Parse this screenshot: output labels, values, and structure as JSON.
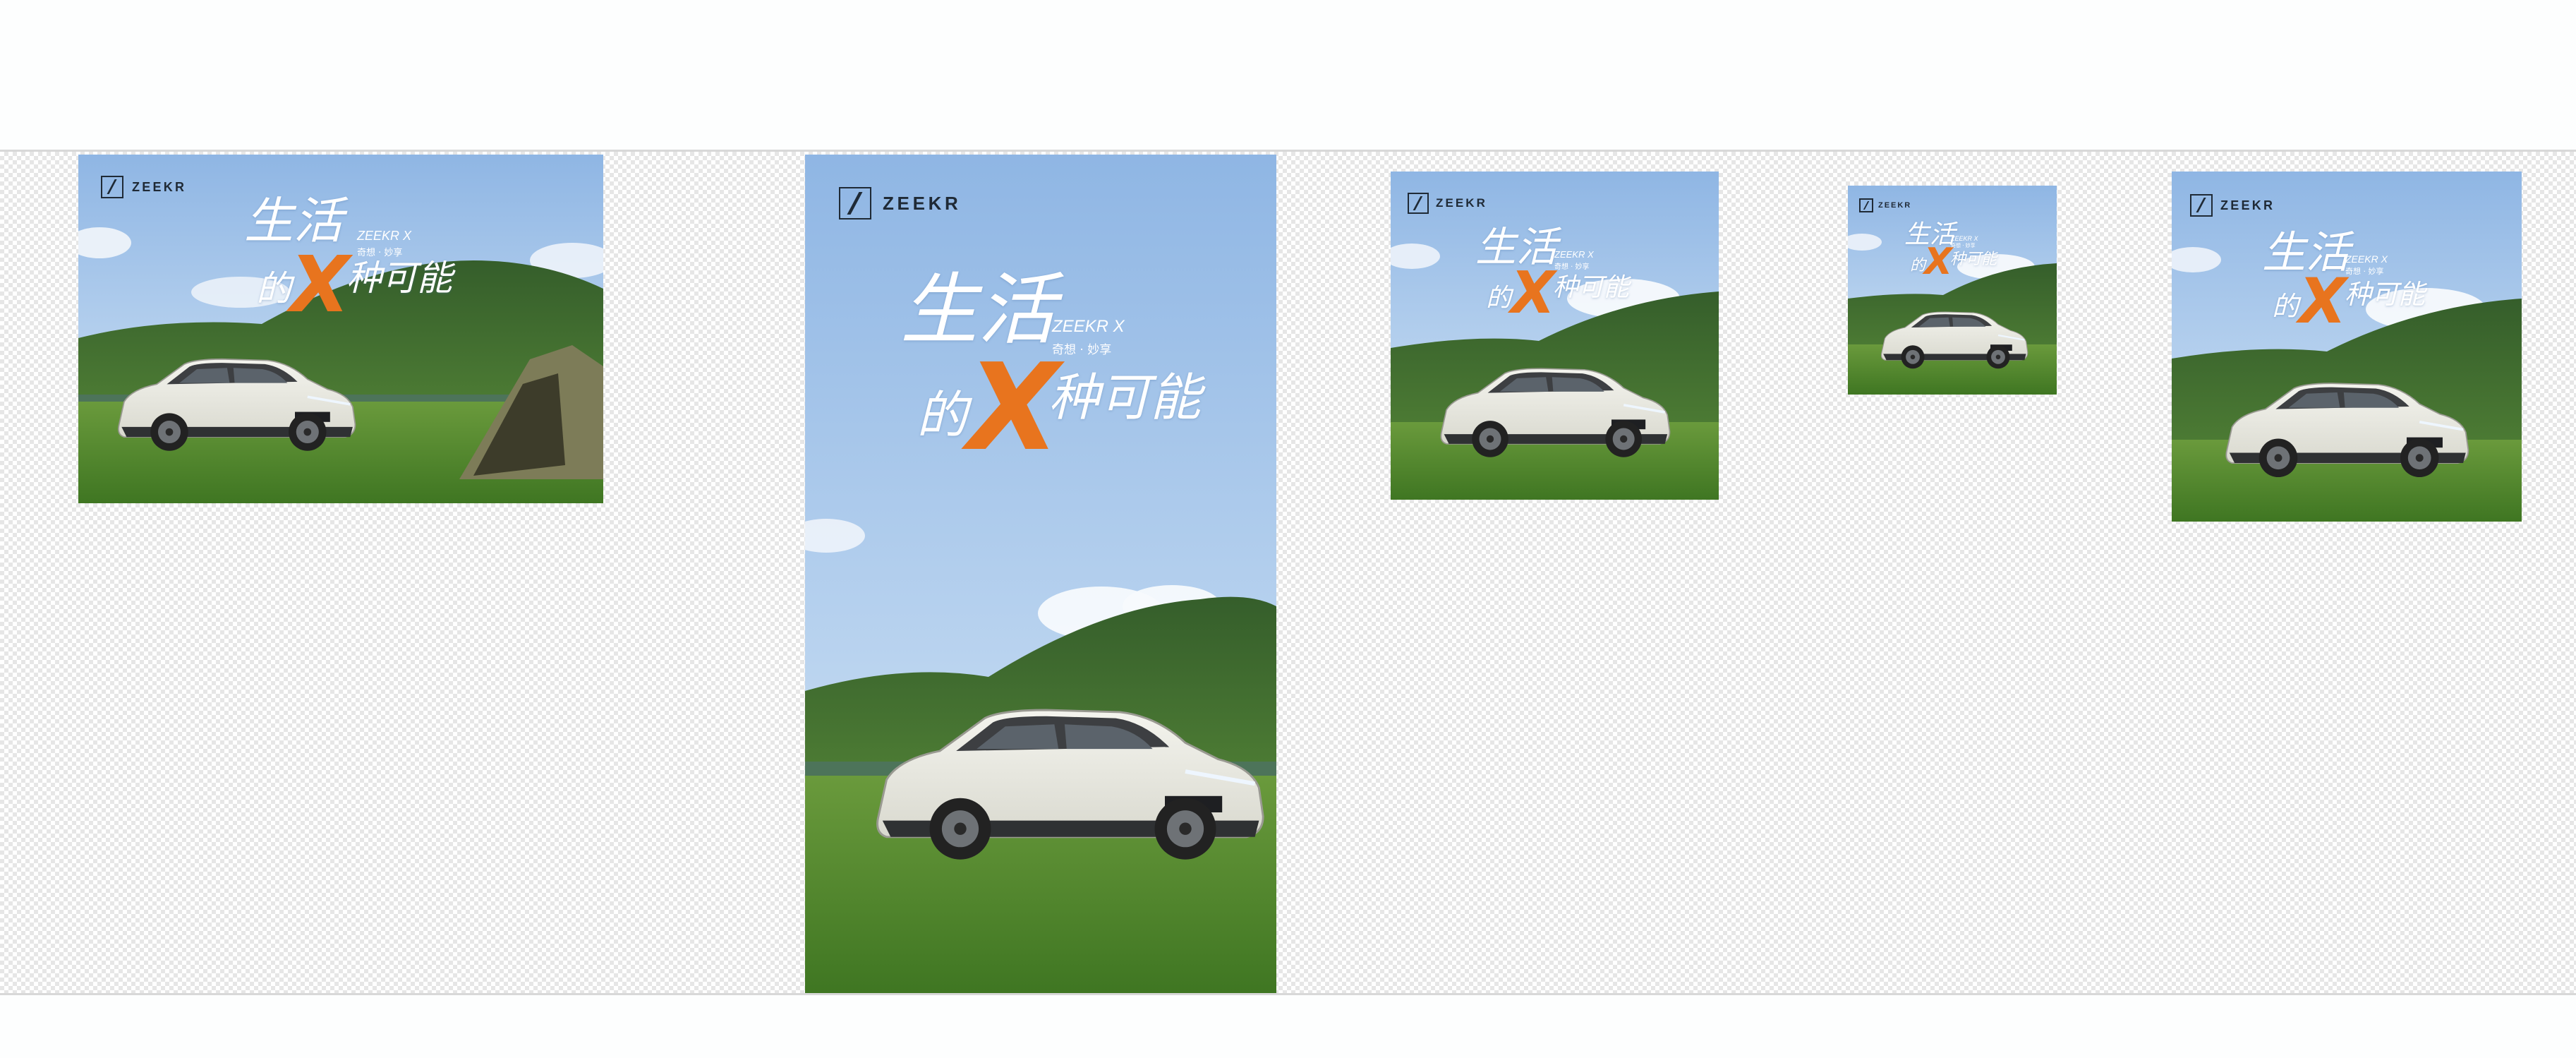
{
  "brand": "ZEEKR",
  "headline": {
    "line1": "生活",
    "de": "的",
    "x": "X",
    "rest": "种可能"
  },
  "subtitle": {
    "model": "ZEEKR X",
    "tagline": "奇想 · 妙享"
  },
  "plate": "ZEEKR X",
  "colors": {
    "accent": "#e8741e",
    "sky": "#9dbfe6",
    "grass": "#4f8a2a",
    "car": "#ecece4"
  }
}
